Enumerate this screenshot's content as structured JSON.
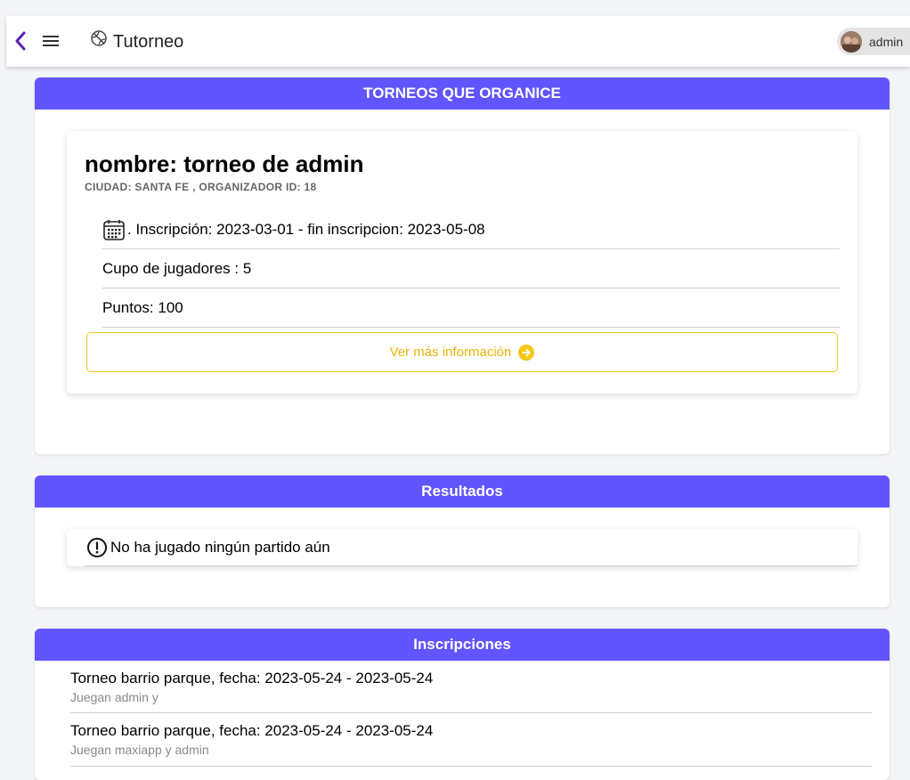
{
  "header": {
    "title": "Tutorneo",
    "user_name": "admin"
  },
  "organized": {
    "section_title": "TORNEOS QUE ORGANICE",
    "tournament": {
      "name": "nombre: torneo de admin",
      "subtitle": "CIUDAD: SANTA FE , ORGANIZADOR ID: 18",
      "inscription": ". Inscripción: 2023-03-01 - fin inscripcion: 2023-05-08",
      "capacity": "Cupo de jugadores : 5",
      "points": "Puntos: 100",
      "more_info_label": "Ver más información"
    }
  },
  "results": {
    "section_title": "Resultados",
    "empty_message": "No ha jugado ningún partido aún"
  },
  "inscriptions": {
    "section_title": "Inscripciones",
    "items": [
      {
        "title": "Torneo barrio parque, fecha: 2023-05-24 - 2023-05-24",
        "players": "Juegan admin y"
      },
      {
        "title": "Torneo barrio parque, fecha: 2023-05-24 - 2023-05-24",
        "players": "Juegan maxiapp y admin"
      }
    ]
  },
  "colors": {
    "section_header": "#6155ff",
    "accent_yellow": "#eab308",
    "back_arrow": "#5b21b6"
  }
}
